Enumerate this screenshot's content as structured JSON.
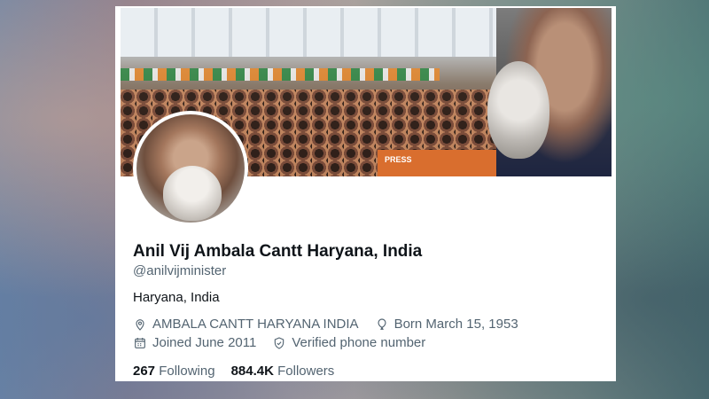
{
  "profile": {
    "display_name": "Anil Vij Ambala Cantt Haryana, India",
    "handle": "@anilvijminister",
    "bio": "Haryana, India",
    "location": "AMBALA CANTT HARYANA INDIA",
    "born": "Born March 15, 1953",
    "joined": "Joined June 2011",
    "verified_phone": "Verified phone number",
    "following_count": "267",
    "following_label": "Following",
    "followers_count": "884.4K",
    "followers_label": "Followers"
  },
  "banner": {
    "press_text": "PRESS"
  },
  "icons": {
    "location": "location-pin-icon",
    "born": "balloon-icon",
    "joined": "calendar-icon",
    "verified": "shield-check-icon"
  }
}
